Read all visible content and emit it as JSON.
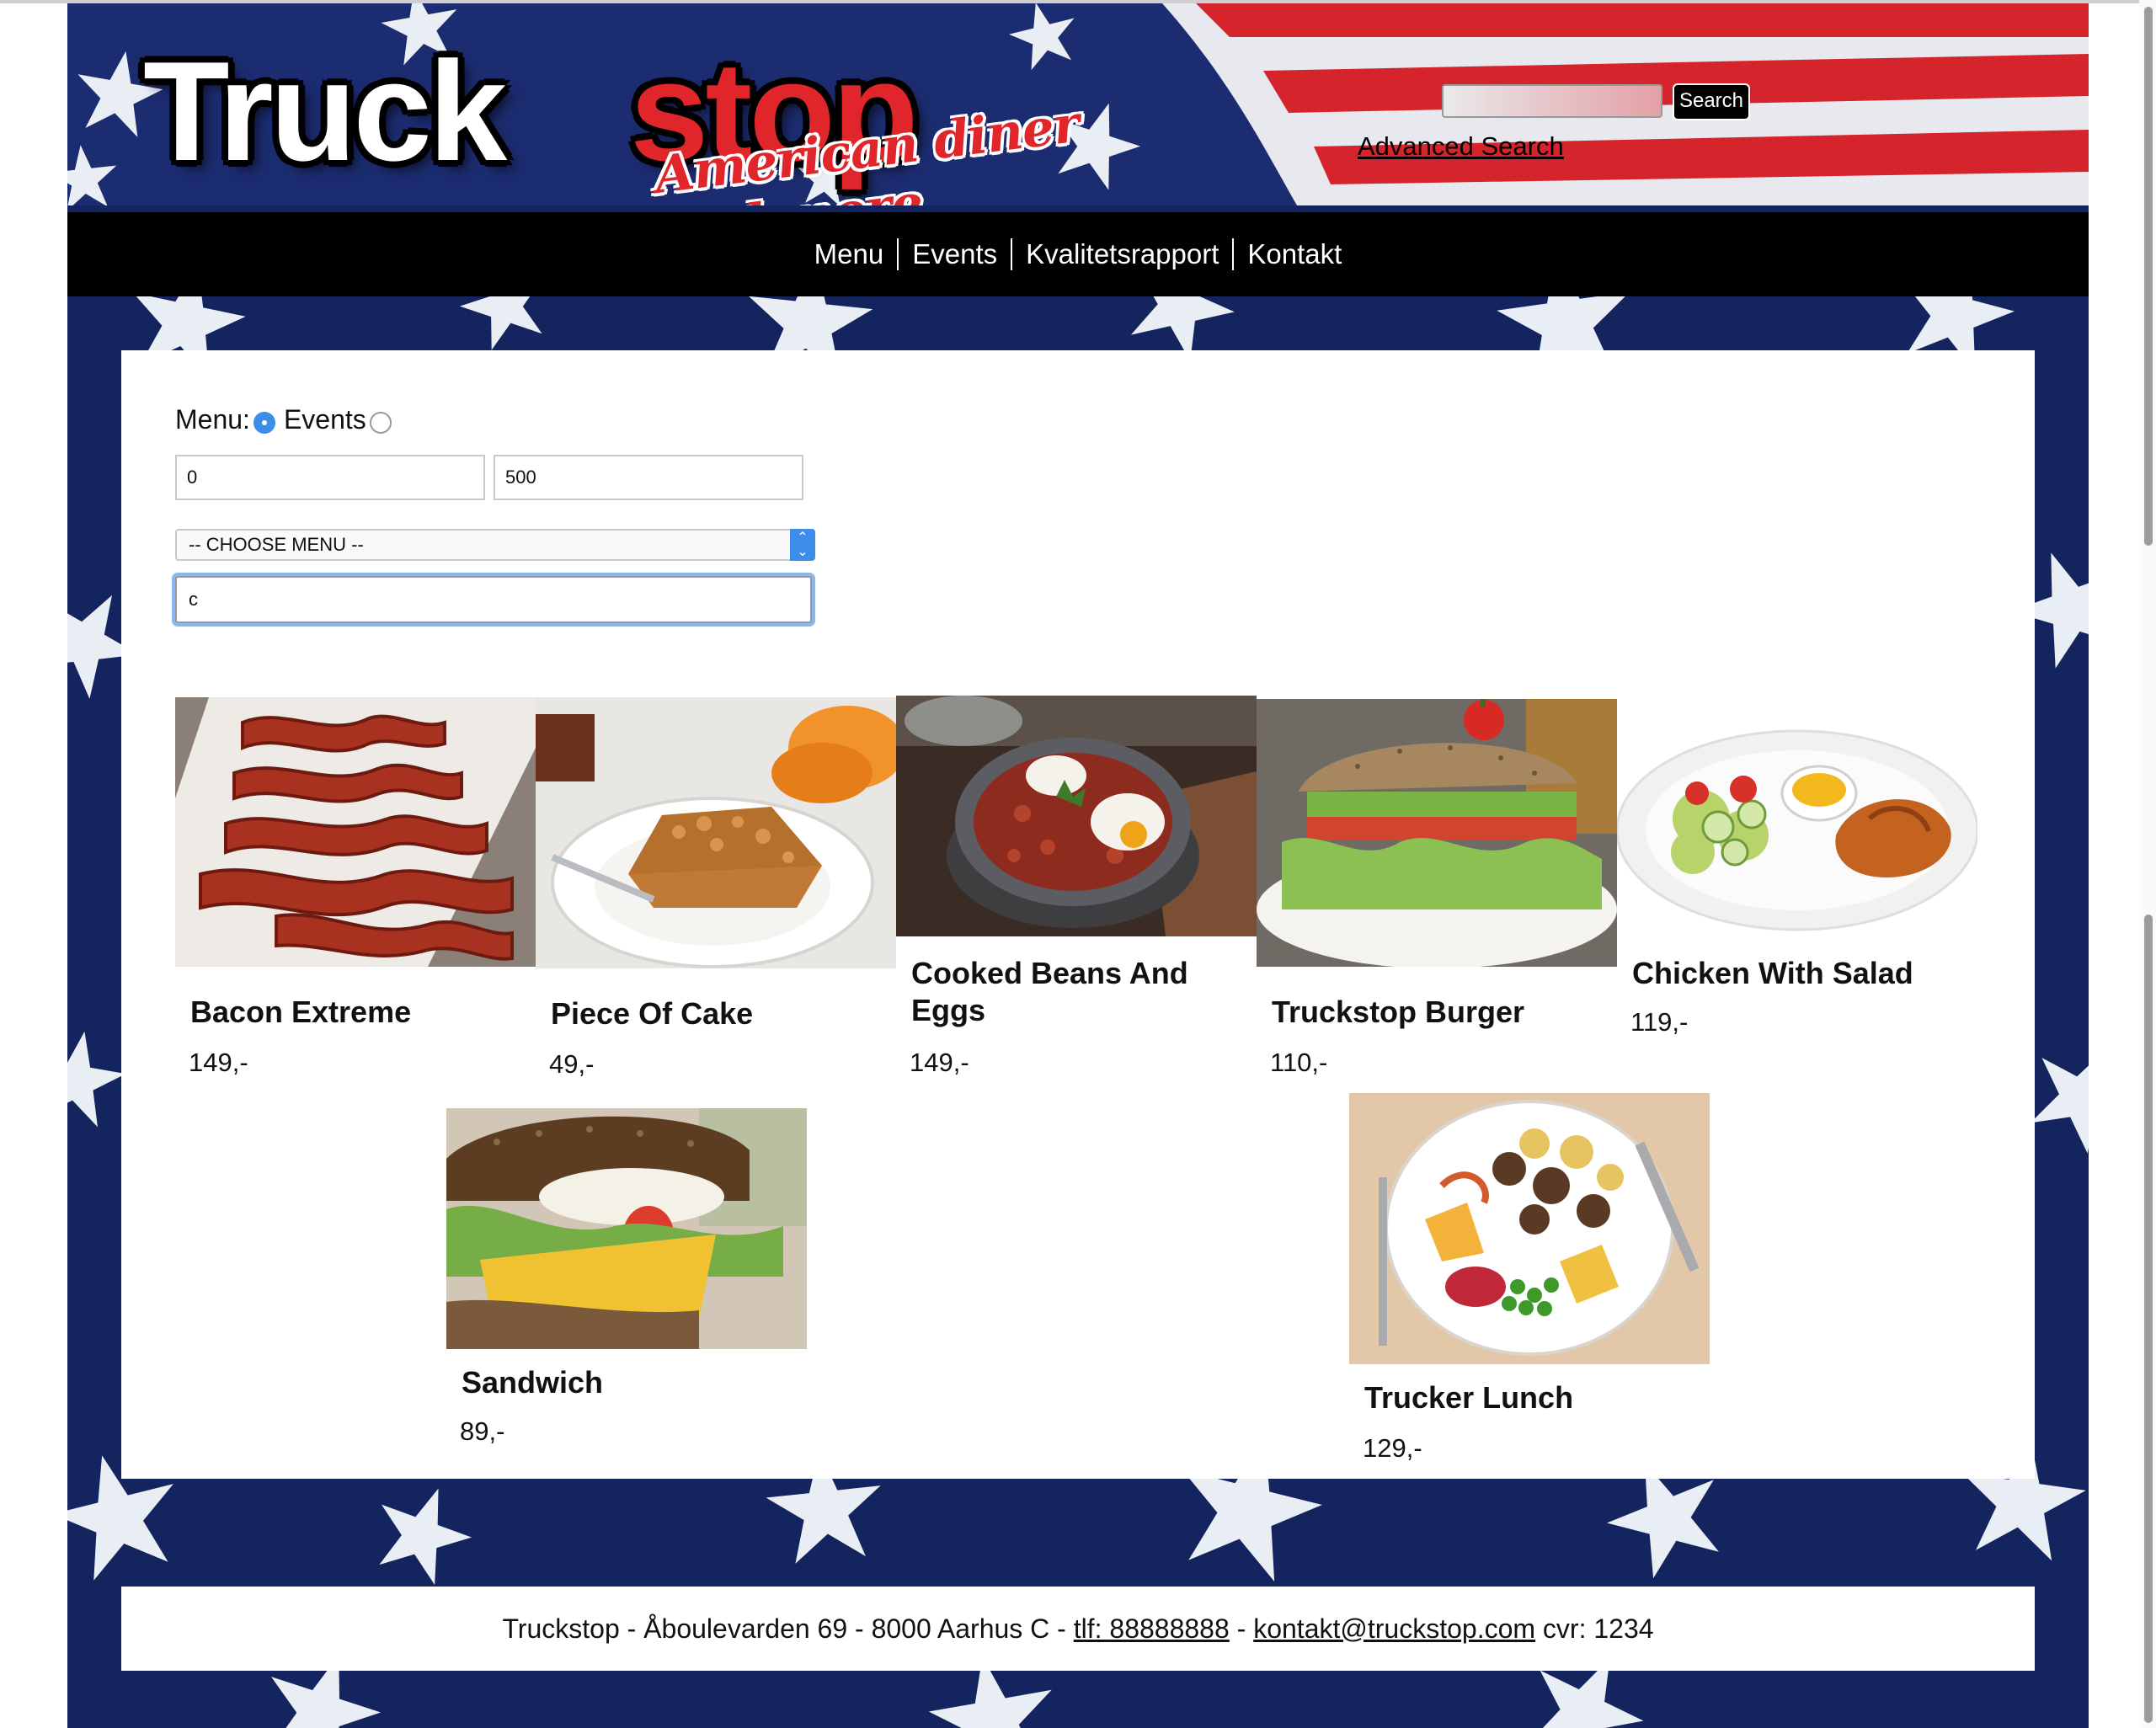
{
  "header": {
    "logo_main": "Truck",
    "logo_accent": "stop",
    "logo_tagline": "American diner and more",
    "search_value": "",
    "search_button": "Search",
    "advanced_search": "Advanced Search"
  },
  "nav": {
    "items": [
      "Menu",
      "Events",
      "Kvalitetsrapport",
      "Kontakt"
    ]
  },
  "filters": {
    "radio_menu_label": "Menu:",
    "radio_events_label": "Events",
    "selected_type": "Menu",
    "price_min": "0",
    "price_max": "500",
    "menu_select": "-- CHOOSE MENU --",
    "query": "c"
  },
  "products": [
    {
      "name": "Bacon Extreme",
      "price": "149,-",
      "image": "bacon"
    },
    {
      "name": "Piece Of Cake",
      "price": "49,-",
      "image": "cake"
    },
    {
      "name": "Cooked Beans And Eggs",
      "price": "149,-",
      "image": "beans-and-eggs"
    },
    {
      "name": "Truckstop Burger",
      "price": "110,-",
      "image": "burger"
    },
    {
      "name": "Chicken With Salad",
      "price": "119,-",
      "image": "chicken-salad"
    },
    {
      "name": "Sandwich",
      "price": "89,-",
      "image": "sandwich"
    },
    {
      "name": "Trucker Lunch",
      "price": "129,-",
      "image": "lunch-plate"
    }
  ],
  "footer": {
    "address": "Truckstop - Åboulevarden 69 - 8000 Aarhus C - ",
    "phone": "tlf: 88888888",
    "sep": " - ",
    "email": "kontakt@truckstop.com",
    "cvr": " cvr: 1234"
  },
  "colors": {
    "flag_blue": "#14245f",
    "flag_red": "#e0262a",
    "accent_blue": "#3d8ee8",
    "nav_bg": "#000000"
  }
}
